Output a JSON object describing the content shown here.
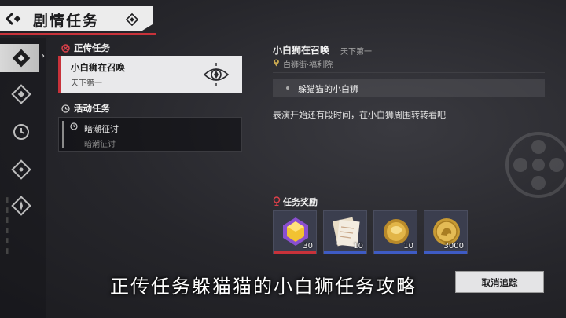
{
  "header": {
    "title": "剧情任务"
  },
  "nav": {
    "items": [
      "main-quest-icon",
      "gem-icon",
      "clock-icon",
      "diamond-compass-icon",
      "star-compass-icon"
    ]
  },
  "quest_list": {
    "main_section_label": "正传任务",
    "main_quest": {
      "title": "小白狮在召唤",
      "subtitle": "天下第一"
    },
    "event_section_label": "活动任务",
    "event_quest": {
      "title": "暗潮征讨",
      "subtitle": "暗潮征讨"
    }
  },
  "detail": {
    "title": "小白狮在召唤",
    "subtitle": "天下第一",
    "location": "白狮街·福利院",
    "objective": "躲猫猫的小白狮",
    "description": "表演开始还有段时间，在小白狮周围转转看吧"
  },
  "rewards": {
    "label": "任务奖励",
    "items": [
      {
        "icon": "yellow-gem-icon",
        "count": "30",
        "bar_color": "#c8323a"
      },
      {
        "icon": "scroll-icon",
        "count": "10",
        "bar_color": "#3e5bc4"
      },
      {
        "icon": "gold-coin-icon",
        "count": "10",
        "bar_color": "#3e5bc4"
      },
      {
        "icon": "gold-lion-coin-icon",
        "count": "3000",
        "bar_color": "#3e5bc4"
      }
    ]
  },
  "caption": "正传任务躲猫猫的小白狮任务攻略",
  "actions": {
    "cancel_tracking": "取消追踪"
  }
}
